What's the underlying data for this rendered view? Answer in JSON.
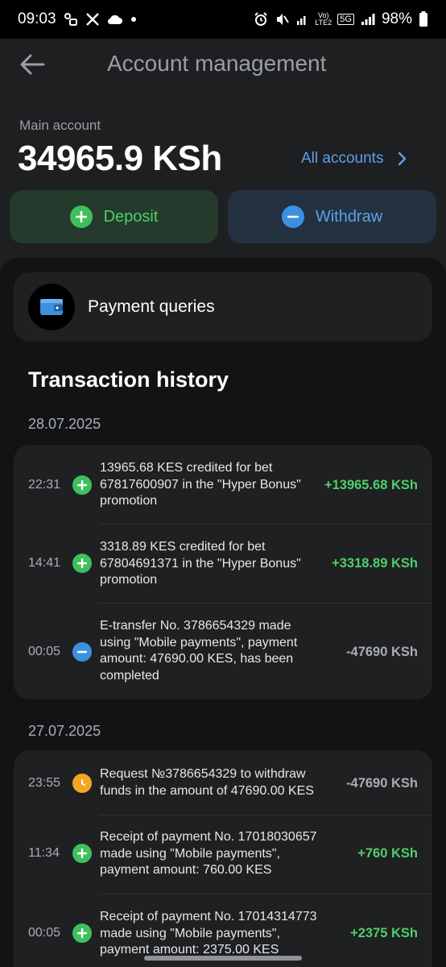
{
  "status": {
    "time": "09:03",
    "battery": "98%",
    "volte_label": "Vo) LTE2",
    "network_label": "5G"
  },
  "header": {
    "title": "Account management"
  },
  "account": {
    "label": "Main account",
    "balance": "34965.9 KSh",
    "all_accounts_label": "All accounts"
  },
  "actions": {
    "deposit_label": "Deposit",
    "withdraw_label": "Withdraw"
  },
  "payment_queries": {
    "label": "Payment queries"
  },
  "history": {
    "title": "Transaction history",
    "groups": [
      {
        "date": "28.07.2025",
        "items": [
          {
            "time": "22:31",
            "icon": "plus-icon",
            "description": "13965.68 KES credited for bet 67817600907 in the \"Hyper Bonus\" promotion",
            "amount": "+13965.68 KSh"
          },
          {
            "time": "14:41",
            "icon": "plus-icon",
            "description": "3318.89 KES credited for bet 67804691371 in the \"Hyper Bonus\" promotion",
            "amount": "+3318.89 KSh"
          },
          {
            "time": "00:05",
            "icon": "minus-icon",
            "description": "E-transfer No. 3786654329 made using \"Mobile payments\", payment amount: 47690.00 KES, has been completed",
            "amount": "-47690 KSh"
          }
        ]
      },
      {
        "date": "27.07.2025",
        "items": [
          {
            "time": "23:55",
            "icon": "clock-icon",
            "description": "Request №3786654329 to withdraw funds in the amount of 47690.00 KES",
            "amount": "-47690 KSh"
          },
          {
            "time": "11:34",
            "icon": "plus-icon",
            "description": "Receipt of payment No. 17018030657 made using \"Mobile payments\", payment amount: 760.00 KES",
            "amount": "+760 KSh"
          },
          {
            "time": "00:05",
            "icon": "plus-icon",
            "description": "Receipt of payment No. 17014314773 made using \"Mobile payments\", payment amount: 2375.00 KES",
            "amount": "+2375 KSh"
          }
        ]
      }
    ]
  },
  "colors": {
    "positive": "#4fcf6a",
    "accent_blue": "#5aa2ea",
    "pending": "#f2a623"
  }
}
